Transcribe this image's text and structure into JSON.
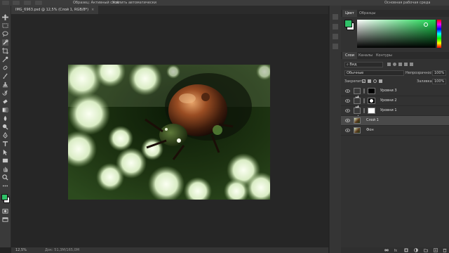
{
  "options_bar": {
    "items": [
      "Образец: Активный слой",
      "Усилить автоматически"
    ]
  },
  "document": {
    "tab_title": "IMG_6963.psd @ 12,5% (Слой 1, RGB/8*)",
    "close_glyph": "×",
    "photo_subject": "Metallic bronze beetle on white flower cluster"
  },
  "workspace_label": "Основная рабочая среда",
  "status": {
    "zoom": "12,5%",
    "doc_info": "Док: 51,3M/165,0M"
  },
  "color_panel": {
    "tabs": [
      "Цвет",
      "Образцы"
    ],
    "foreground": "#2fc168",
    "background": "#ffffff",
    "hue_accent": "#19d84f"
  },
  "layers_panel": {
    "tabs": [
      "Слои",
      "Каналы",
      "Контуры"
    ],
    "search_kind": "Вид",
    "blend_mode": "Обычные",
    "opacity_label": "Непрозрачность:",
    "opacity_value": "100%",
    "lock_label": "Закрепить:",
    "fill_label": "Заливка:",
    "fill_value": "100%",
    "layers": [
      {
        "name": "Уровни 3",
        "type": "adjustment",
        "mask": "black"
      },
      {
        "name": "Уровни 2",
        "type": "adjustment",
        "mask": "bw"
      },
      {
        "name": "Уровни 1",
        "type": "adjustment",
        "mask": "white"
      },
      {
        "name": "Слой 1",
        "type": "pixel",
        "selected": true
      },
      {
        "name": "Фон",
        "type": "pixel"
      }
    ]
  },
  "tools": [
    "move-icon",
    "marquee-icon",
    "lasso-icon",
    "quick-select-icon",
    "crop-icon",
    "eyedropper-icon",
    "healing-icon",
    "brush-icon",
    "clone-stamp-icon",
    "history-brush-icon",
    "eraser-icon",
    "gradient-icon",
    "blur-icon",
    "dodge-icon",
    "pen-icon",
    "type-icon",
    "path-select-icon",
    "shape-icon",
    "hand-icon",
    "zoom-icon"
  ]
}
